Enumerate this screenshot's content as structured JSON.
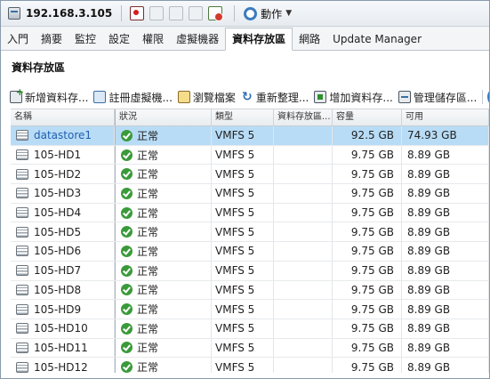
{
  "host": {
    "title": "192.168.3.105"
  },
  "toolbar": {
    "icons": [
      "power-off-icon",
      "power-on-icon",
      "suspend-icon",
      "copy-icon",
      "host-alert-icon"
    ],
    "actions_label": "動作"
  },
  "tabs": [
    {
      "label": "入門"
    },
    {
      "label": "摘要"
    },
    {
      "label": "監控"
    },
    {
      "label": "設定"
    },
    {
      "label": "權限"
    },
    {
      "label": "虛擬機器"
    },
    {
      "label": "資料存放區",
      "active": true
    },
    {
      "label": "網路"
    },
    {
      "label": "Update Manager"
    }
  ],
  "section": {
    "title": "資料存放區"
  },
  "actions": {
    "new": "新增資料存...",
    "register": "註冊虛擬機...",
    "browse": "瀏覽檔案",
    "refresh": "重新整理...",
    "increase": "增加資料存...",
    "manage": "管理儲存區..."
  },
  "table": {
    "columns": {
      "name": "名稱",
      "status": "狀況",
      "type": "類型",
      "cluster": "資料存放區...",
      "capacity": "容量",
      "free": "可用"
    },
    "rows": [
      {
        "name": "datastore1",
        "status": "正常",
        "type": "VMFS 5",
        "cluster": "",
        "capacity": "92.5 GB",
        "free": "74.93 GB",
        "selected": true
      },
      {
        "name": "105-HD1",
        "status": "正常",
        "type": "VMFS 5",
        "cluster": "",
        "capacity": "9.75 GB",
        "free": "8.89 GB"
      },
      {
        "name": "105-HD2",
        "status": "正常",
        "type": "VMFS 5",
        "cluster": "",
        "capacity": "9.75 GB",
        "free": "8.89 GB"
      },
      {
        "name": "105-HD3",
        "status": "正常",
        "type": "VMFS 5",
        "cluster": "",
        "capacity": "9.75 GB",
        "free": "8.89 GB"
      },
      {
        "name": "105-HD4",
        "status": "正常",
        "type": "VMFS 5",
        "cluster": "",
        "capacity": "9.75 GB",
        "free": "8.89 GB"
      },
      {
        "name": "105-HD5",
        "status": "正常",
        "type": "VMFS 5",
        "cluster": "",
        "capacity": "9.75 GB",
        "free": "8.89 GB"
      },
      {
        "name": "105-HD6",
        "status": "正常",
        "type": "VMFS 5",
        "cluster": "",
        "capacity": "9.75 GB",
        "free": "8.89 GB"
      },
      {
        "name": "105-HD7",
        "status": "正常",
        "type": "VMFS 5",
        "cluster": "",
        "capacity": "9.75 GB",
        "free": "8.89 GB"
      },
      {
        "name": "105-HD8",
        "status": "正常",
        "type": "VMFS 5",
        "cluster": "",
        "capacity": "9.75 GB",
        "free": "8.89 GB"
      },
      {
        "name": "105-HD9",
        "status": "正常",
        "type": "VMFS 5",
        "cluster": "",
        "capacity": "9.75 GB",
        "free": "8.89 GB"
      },
      {
        "name": "105-HD10",
        "status": "正常",
        "type": "VMFS 5",
        "cluster": "",
        "capacity": "9.75 GB",
        "free": "8.89 GB"
      },
      {
        "name": "105-HD11",
        "status": "正常",
        "type": "VMFS 5",
        "cluster": "",
        "capacity": "9.75 GB",
        "free": "8.89 GB"
      },
      {
        "name": "105-HD12",
        "status": "正常",
        "type": "VMFS 5",
        "cluster": "",
        "capacity": "9.75 GB",
        "free": "8.89 GB"
      }
    ]
  },
  "colors": {
    "selected_row": "#b8dcf6",
    "status_ok": "#3a9a3a",
    "link_blue": "#1f5fb0",
    "accent": "#3b7bbf"
  }
}
